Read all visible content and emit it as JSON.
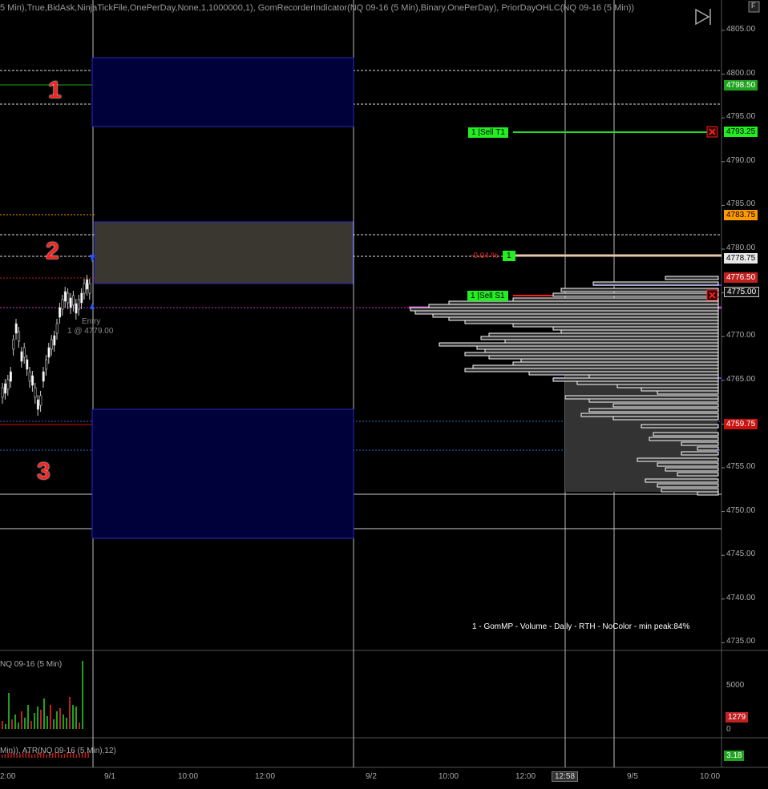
{
  "header": {
    "indicator_text": "5 Min),True,BidAsk,NinjaTickFile,OnePerDay,None,1,1000000,1), GomRecorderIndicator(NQ 09-16 (5 Min),Binary,OnePerDay), PriorDayOHLC(NQ 09-16 (5 Min))",
    "f_button": "F"
  },
  "zone_labels": [
    "1",
    "2",
    "3"
  ],
  "price_axis": {
    "ticks": [
      "4805.00",
      "4800.00",
      "4795.00",
      "4790.00",
      "4785.00",
      "4780.00",
      "4775.00",
      "4770.00",
      "4765.00",
      "4760.00",
      "4755.00",
      "4750.00",
      "4745.00",
      "4740.00",
      "4735.00"
    ]
  },
  "price_tags": [
    {
      "label": "4798.50",
      "color": "#1fa31f"
    },
    {
      "label": "4793.25",
      "color": "#22ee22"
    },
    {
      "label": "4783.75",
      "color": "#ff9900"
    },
    {
      "label": "4778.75",
      "color": "#e8e8e8"
    },
    {
      "label": "4776.50",
      "color": "#c02020"
    },
    {
      "label": "4775.00",
      "color": "#111111"
    },
    {
      "label": "4759.75",
      "color": "#cc1111"
    }
  ],
  "orders": {
    "target": "1 |Sell T1",
    "stop": "1 |Sell S1",
    "pnl_percent": "-0.04 %",
    "position_qty": "1"
  },
  "entry": {
    "label": "Entry",
    "detail": "1 @ 4779.00"
  },
  "profile_caption": "1 - GomMP  - Volume - Daily - RTH - NoColor - min peak:84%",
  "volume_panel": {
    "title": "NQ 09-16 (5 Min)",
    "ticks": [
      "5000",
      "0"
    ],
    "current_tag": "1279"
  },
  "atr_panel": {
    "title": "Min)), ATR(NQ 09-16 (5 Min),12)",
    "current_tag": "3.18"
  },
  "time_axis": {
    "labels": [
      "2:00",
      "9/1",
      "10:00",
      "12:00",
      "9/2",
      "10:00",
      "12:00",
      "12:58",
      "9/5",
      "10:00"
    ]
  },
  "colors": {
    "zone_fill": "#00003a",
    "zone_border": "#2a2ac8",
    "entry_zone_fill": "#3a3630",
    "target_line": "#22dd22",
    "stop_line": "#ee2222",
    "poc_line": "#cc33cc",
    "profile_fill": "#333333"
  }
}
